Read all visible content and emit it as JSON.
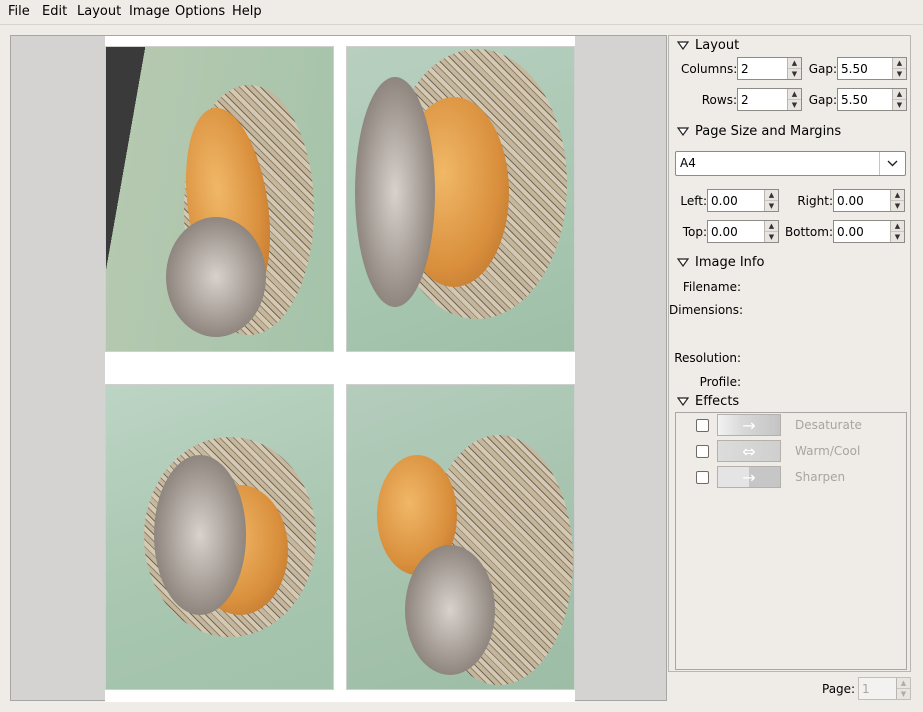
{
  "menubar": {
    "items": [
      {
        "label": "File"
      },
      {
        "label": "Edit"
      },
      {
        "label": "Layout"
      },
      {
        "label": "Image"
      },
      {
        "label": "Options"
      },
      {
        "label": "Help"
      }
    ]
  },
  "panel": {
    "layout": {
      "title": "Layout",
      "columns_label": "Columns:",
      "columns_value": "2",
      "rows_label": "Rows:",
      "rows_value": "2",
      "col_gap_label": "Gap:",
      "col_gap_value": "5.50",
      "row_gap_label": "Gap:",
      "row_gap_value": "5.50"
    },
    "page_size": {
      "title": "Page Size and Margins",
      "paper": "A4",
      "left_label": "Left:",
      "left_value": "0.00",
      "right_label": "Right:",
      "right_value": "0.00",
      "top_label": "Top:",
      "top_value": "0.00",
      "bottom_label": "Bottom:",
      "bottom_value": "0.00"
    },
    "image_info": {
      "title": "Image Info",
      "filename_label": "Filename:",
      "dimensions_label": "Dimensions:",
      "resolution_label": "Resolution:",
      "profile_label": "Profile:"
    },
    "effects": {
      "title": "Effects",
      "items": [
        {
          "label": "Desaturate",
          "checked": false
        },
        {
          "label": "Warm/Cool",
          "checked": false
        },
        {
          "label": "Sharpen",
          "checked": false
        }
      ]
    }
  },
  "footer": {
    "page_label": "Page:",
    "page_value": "1"
  }
}
